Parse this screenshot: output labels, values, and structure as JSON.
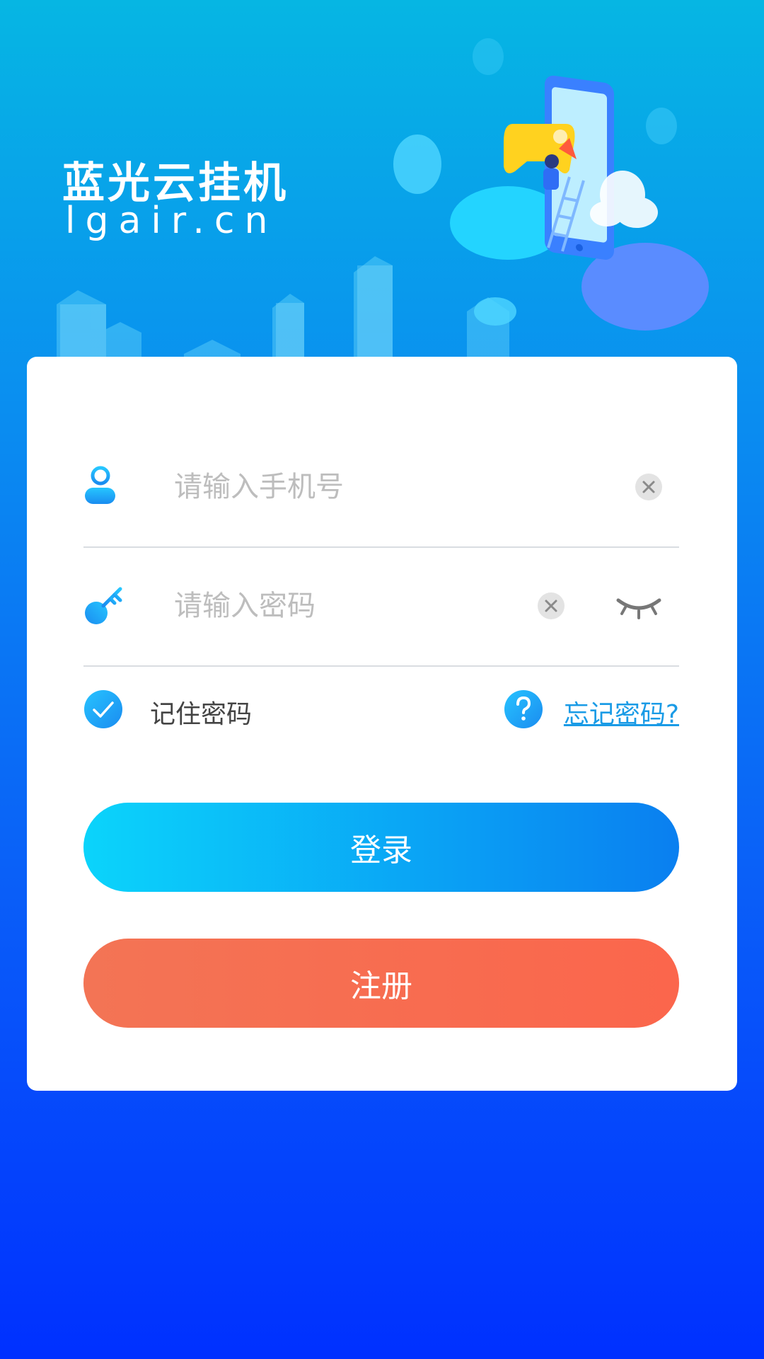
{
  "brand": {
    "title": "蓝光云挂机",
    "domain": "lgair.cn"
  },
  "illustration": {
    "icon": "phone-with-game-controller-illustration"
  },
  "login_form": {
    "phone": {
      "icon": "user-icon",
      "placeholder": "请输入手机号",
      "value": ""
    },
    "password": {
      "icon": "key-icon",
      "placeholder": "请输入密码",
      "value": ""
    },
    "remember": {
      "label": "记住密码",
      "checked": true
    },
    "forgot_label": "忘记密码?",
    "login_label": "登录",
    "register_label": "注册"
  },
  "colors": {
    "accent": "#1a9be6",
    "login_start": "#0bd4fb",
    "login_end": "#0a7ff0",
    "register": "#f76a4f"
  }
}
